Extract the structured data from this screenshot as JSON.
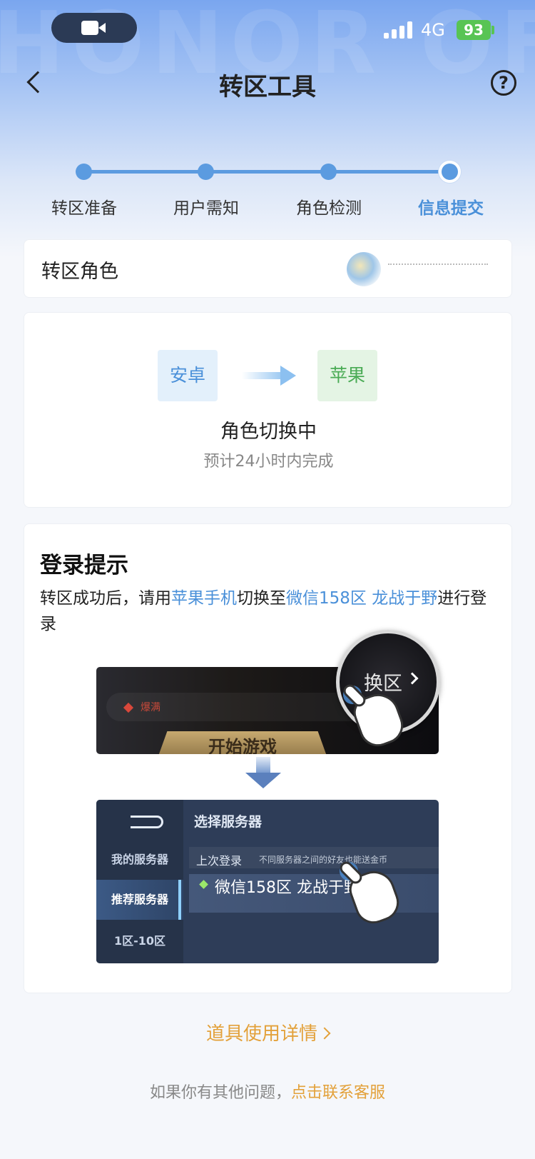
{
  "status_bar": {
    "network": "4G",
    "battery": "93"
  },
  "nav": {
    "title": "转区工具",
    "help_icon": "?"
  },
  "stepper": {
    "steps": [
      "转区准备",
      "用户需知",
      "角色检测",
      "信息提交"
    ],
    "current_index": 3
  },
  "role": {
    "label": "转区角色"
  },
  "switch": {
    "from": "安卓",
    "to": "苹果",
    "status": "角色切换中",
    "eta": "预计24小时内完成"
  },
  "login_tip": {
    "title": "登录提示",
    "desc_prefix": "转区成功后，请用",
    "device": "苹果手机",
    "desc_mid": "切换至",
    "server": "微信158区 龙战于野",
    "desc_suffix": "进行登录"
  },
  "illustration_1": {
    "tag": "爆满",
    "start_button": "开始游戏",
    "switch_label": "换区"
  },
  "illustration_2": {
    "title": "选择服务器",
    "nav_items": [
      "我的服务器",
      "推荐服务器",
      "1区-10区"
    ],
    "last_login": "上次登录",
    "note": "不同服务器之间的好友也能送金币",
    "server_name": "微信158区 龙战于野"
  },
  "links": {
    "detail": "道具使用详情",
    "footer_prefix": "如果你有其他问题，",
    "footer_link": "点击联系客服"
  },
  "colors": {
    "accent": "#4a90d9",
    "link": "#e3a13a",
    "green": "#4aab55"
  }
}
